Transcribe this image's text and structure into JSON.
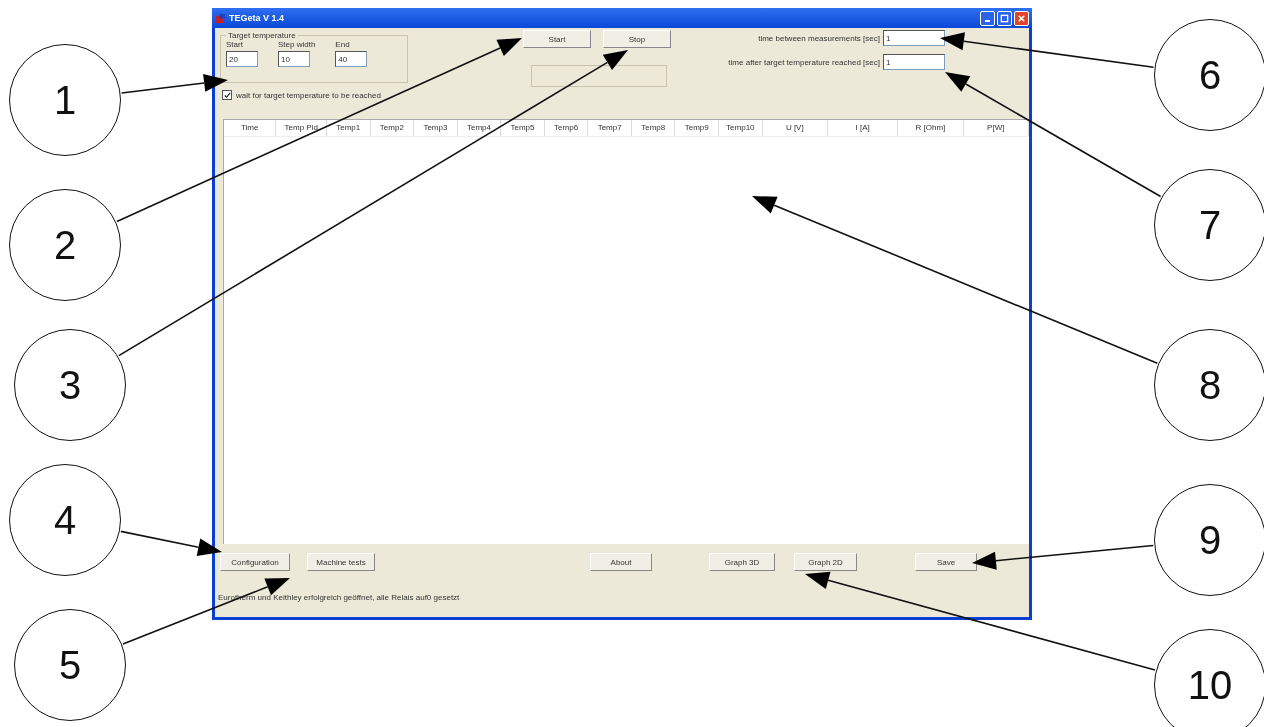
{
  "window": {
    "title": "TEGeta V 1.4"
  },
  "target_temperature": {
    "title": "Target temperature",
    "fields": [
      {
        "label": "Start",
        "value": "20"
      },
      {
        "label": "Step width",
        "value": "10"
      },
      {
        "label": "End",
        "value": "40"
      }
    ]
  },
  "wait_checkbox": {
    "label": "wait for target temperature to be reached",
    "checked": true
  },
  "run_buttons": [
    "Start",
    "Stop"
  ],
  "timing_fields": [
    {
      "label": "time between measurements [sec]",
      "value": "1"
    },
    {
      "label": "time after target temperature reached  [sec]",
      "value": "1"
    }
  ],
  "table": {
    "columns": [
      "Time",
      "Temp Pid",
      "Temp1",
      "Temp2",
      "Temp3",
      "Temp4",
      "Temp5",
      "Temp6",
      "Temp7",
      "Temp8",
      "Temp9",
      "Temp10",
      "U [V]",
      "I [A]",
      "R [Ohm]",
      "P[W]"
    ]
  },
  "bottom_buttons": [
    "Configuration",
    "Machine tests",
    "About",
    "Graph 3D",
    "Graph 2D",
    "Save"
  ],
  "status_bar": "Eurotherm und Keithley erfolgreich geöffnet, alle Relais auf0 gesetzt",
  "callouts": [
    "1",
    "2",
    "3",
    "4",
    "5",
    "6",
    "7",
    "8",
    "9",
    "10"
  ]
}
